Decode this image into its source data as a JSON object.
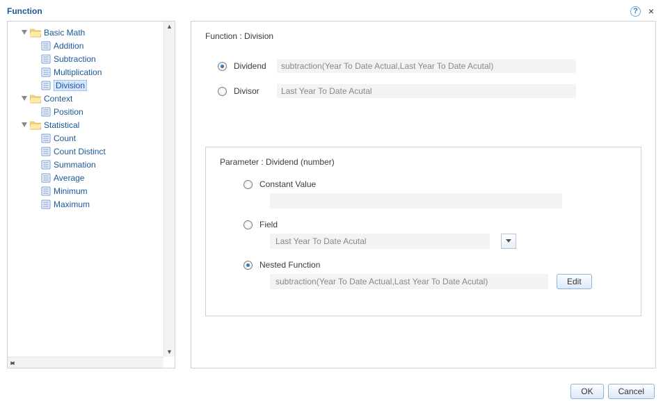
{
  "dialog": {
    "title": "Function",
    "help_tooltip": "?",
    "close_tooltip": "×"
  },
  "tree": {
    "categories": [
      {
        "label": "Basic Math",
        "items": [
          {
            "label": "Addition",
            "selected": false
          },
          {
            "label": "Subtraction",
            "selected": false
          },
          {
            "label": "Multiplication",
            "selected": false
          },
          {
            "label": "Division",
            "selected": true
          }
        ]
      },
      {
        "label": "Context",
        "items": [
          {
            "label": "Position",
            "selected": false
          }
        ]
      },
      {
        "label": "Statistical",
        "items": [
          {
            "label": "Count",
            "selected": false
          },
          {
            "label": "Count Distinct",
            "selected": false
          },
          {
            "label": "Summation",
            "selected": false
          },
          {
            "label": "Average",
            "selected": false
          },
          {
            "label": "Minimum",
            "selected": false
          },
          {
            "label": "Maximum",
            "selected": false
          }
        ]
      }
    ]
  },
  "functionPanel": {
    "title_prefix": "Function : ",
    "title_name": "Division",
    "params": [
      {
        "label": "Dividend",
        "value": "subtraction(Year To Date Actual,Last Year To Date Acutal)",
        "checked": true
      },
      {
        "label": "Divisor",
        "value": "Last Year To Date Acutal",
        "checked": false
      }
    ]
  },
  "parameterPanel": {
    "title": "Parameter : Dividend (number)",
    "options": {
      "constant": {
        "label": "Constant Value",
        "value": "",
        "checked": false
      },
      "field": {
        "label": "Field",
        "value": "Last Year To Date Acutal",
        "checked": false
      },
      "nested": {
        "label": "Nested Function",
        "value": "subtraction(Year To Date Actual,Last Year To Date Acutal)",
        "checked": true
      }
    },
    "edit_label": "Edit"
  },
  "footer": {
    "ok": "OK",
    "cancel": "Cancel"
  }
}
